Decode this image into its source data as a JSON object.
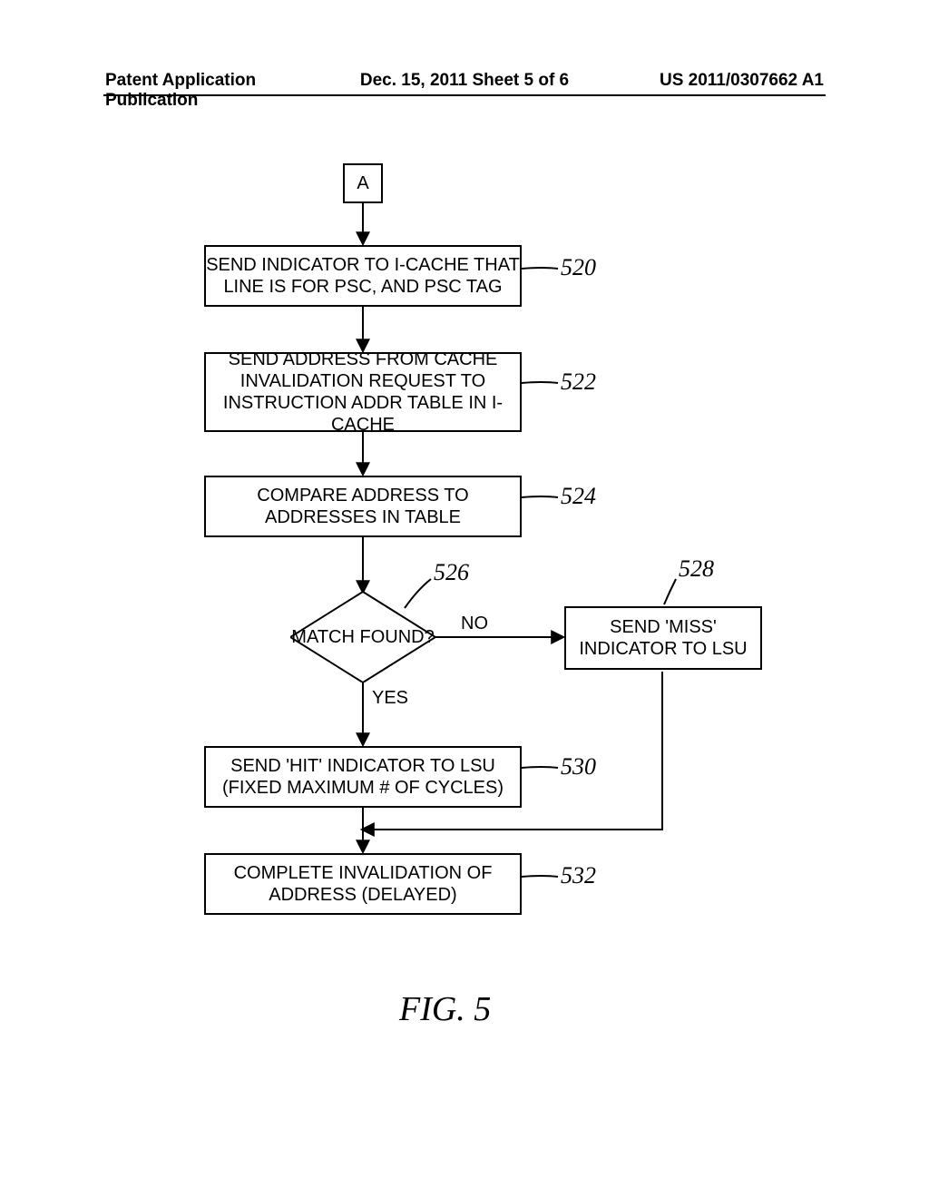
{
  "header": {
    "left": "Patent Application Publication",
    "center": "Dec. 15, 2011   Sheet 5 of 6",
    "right": "US 2011/0307662 A1"
  },
  "nodes": {
    "entry": "A",
    "n520": "SEND INDICATOR TO I-CACHE THAT LINE IS FOR PSC, AND PSC TAG",
    "n522": "SEND ADDRESS FROM CACHE INVALIDATION REQUEST TO INSTRUCTION ADDR TABLE IN I-CACHE",
    "n524": "COMPARE ADDRESS TO ADDRESSES IN TABLE",
    "n526": "MATCH FOUND?",
    "n528": "SEND 'MISS' INDICATOR TO LSU",
    "n530": "SEND 'HIT' INDICATOR TO LSU (FIXED MAXIMUM # OF CYCLES)",
    "n532": "COMPLETE INVALIDATION OF ADDRESS (DELAYED)"
  },
  "refs": {
    "r520": "520",
    "r522": "522",
    "r524": "524",
    "r526": "526",
    "r528": "528",
    "r530": "530",
    "r532": "532"
  },
  "edges": {
    "no": "NO",
    "yes": "YES"
  },
  "figure": "FIG. 5"
}
